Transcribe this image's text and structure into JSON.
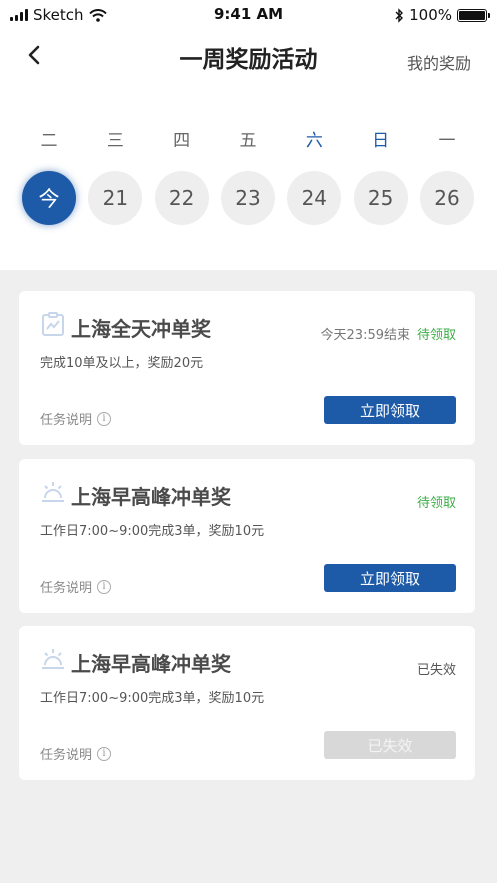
{
  "status_bar": {
    "carrier": "Sketch",
    "time": "9:41 AM",
    "battery": "100%"
  },
  "nav": {
    "title": "一周奖励活动",
    "right_link": "我的奖励"
  },
  "week": {
    "labels": [
      "二",
      "三",
      "四",
      "五",
      "六",
      "日",
      "一"
    ],
    "dates": [
      "今",
      "21",
      "22",
      "23",
      "24",
      "25",
      "26"
    ],
    "weekend_color": "#1d5aa8"
  },
  "cards": [
    {
      "icon": "chart-clipboard-icon",
      "title": "上海全天冲单奖",
      "deadline": "今天23:59结束",
      "status": "待领取",
      "desc": "完成10单及以上，奖励20元",
      "info_label": "任务说明",
      "button": "立即领取"
    },
    {
      "icon": "sunrise-icon",
      "title": "上海早高峰冲单奖",
      "deadline": "",
      "status": "待领取",
      "desc": "工作日7:00~9:00完成3单，奖励10元",
      "info_label": "任务说明",
      "button": "立即领取"
    },
    {
      "icon": "sunrise-icon",
      "title": "上海早高峰冲单奖",
      "deadline": "",
      "status": "已失效",
      "desc": "工作日7:00~9:00完成3单，奖励10元",
      "info_label": "任务说明",
      "button": "已失效"
    }
  ],
  "colors": {
    "primary": "#1d5aa8",
    "claim_green": "#3cae47",
    "background": "#efefef",
    "disabled": "#d8d8d8"
  }
}
